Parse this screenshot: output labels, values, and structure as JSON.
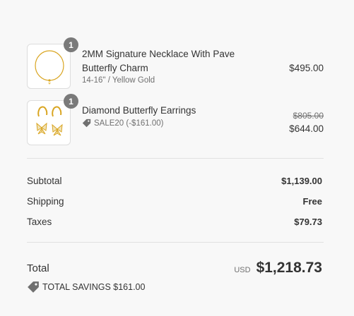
{
  "items": [
    {
      "quantity": "1",
      "title": "2MM Signature Necklace With Pave Butterfly Charm",
      "variant": "14-16\" / Yellow Gold",
      "price": "$495.00",
      "image_icon": "necklace-icon"
    },
    {
      "quantity": "1",
      "title": "Diamond Butterfly Earrings",
      "discount_code": "SALE20 (-$161.00)",
      "original_price": "$805.00",
      "price": "$644.00",
      "image_icon": "earrings-icon"
    }
  ],
  "totals": {
    "subtotal_label": "Subtotal",
    "subtotal_value": "$1,139.00",
    "shipping_label": "Shipping",
    "shipping_value": "Free",
    "taxes_label": "Taxes",
    "taxes_value": "$79.73",
    "total_label": "Total",
    "currency": "USD",
    "total_value": "$1,218.73",
    "savings_text": "TOTAL SAVINGS $161.00"
  },
  "colors": {
    "background": "#f8f8f8",
    "text": "#333333",
    "muted": "#707070",
    "badge": "#7a7a7a",
    "gold": "#d9a521"
  }
}
